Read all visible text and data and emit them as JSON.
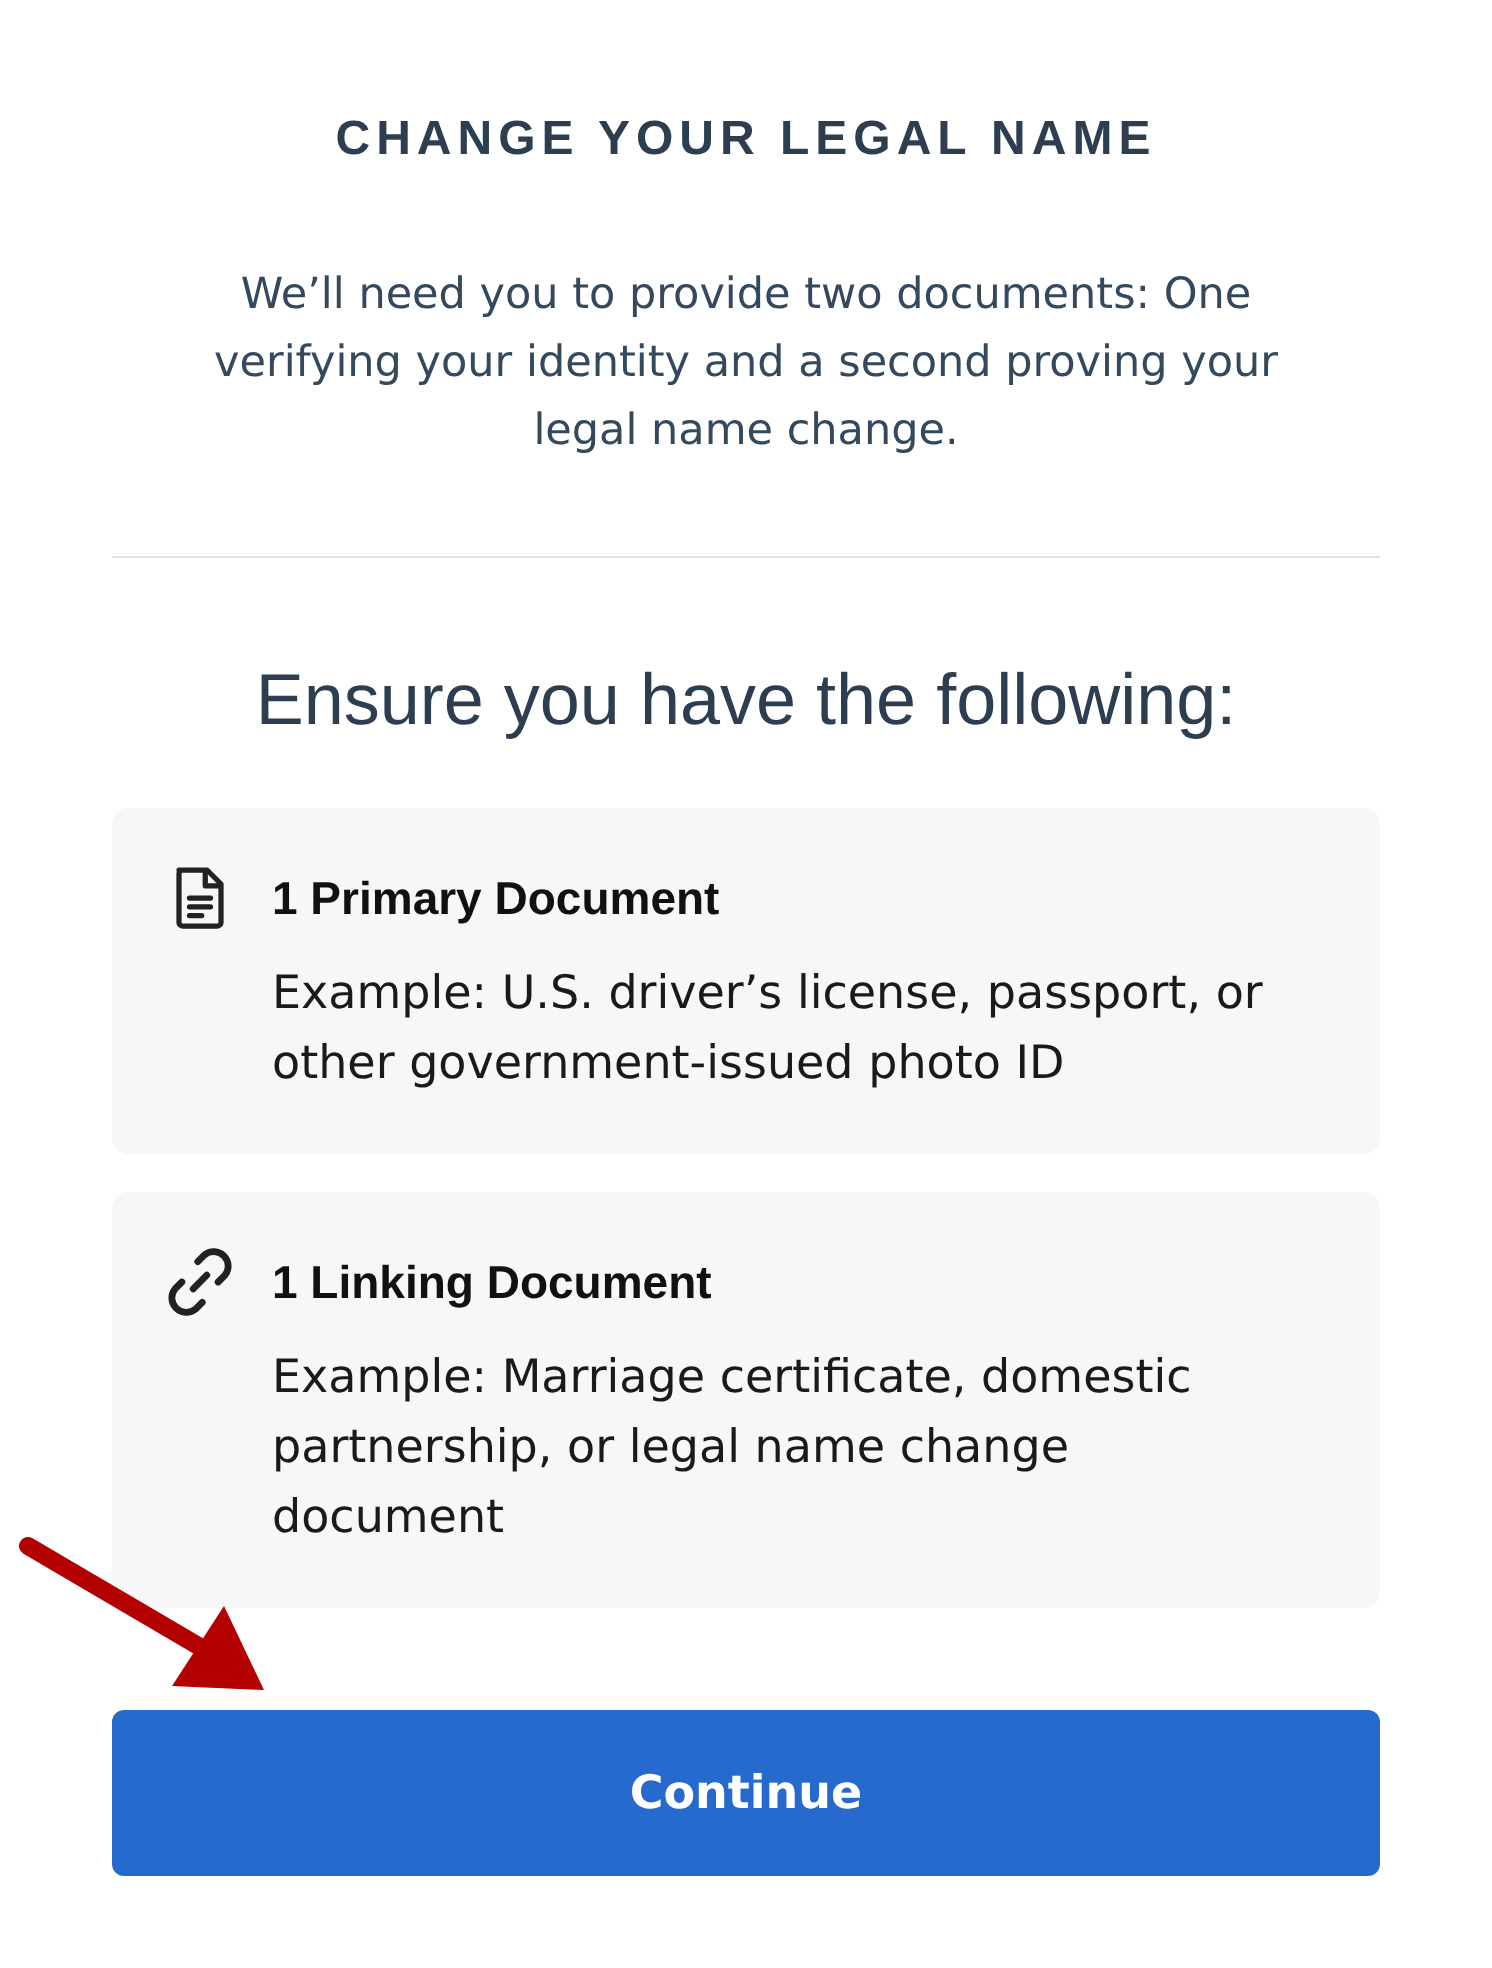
{
  "title": "CHANGE YOUR LEGAL NAME",
  "intro": "We’ll need you to provide two documents: One verifying your identity and a second proving your legal name change.",
  "section_heading": "Ensure you have the following:",
  "documents": [
    {
      "kind": "document",
      "title": "1 Primary Document",
      "description": "Example: U.S. driver’s license, passport, or other government-issued photo ID"
    },
    {
      "kind": "link",
      "title": "1 Linking Document",
      "description": "Example: Marriage certificate, domestic partnership, or legal name change document"
    }
  ],
  "continue_button": "Continue"
}
